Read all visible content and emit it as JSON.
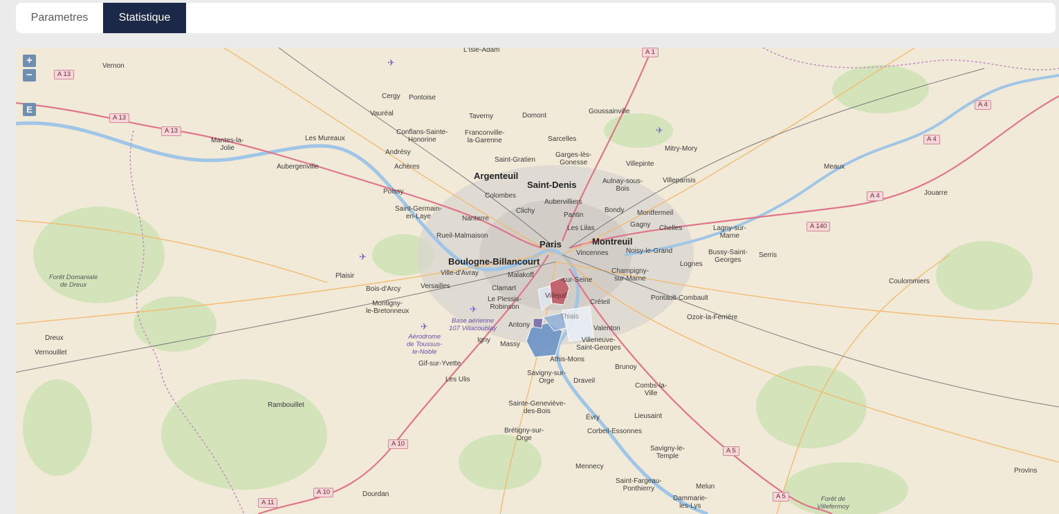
{
  "tabs": [
    {
      "label": "Parametres",
      "active": false
    },
    {
      "label": "Statistique",
      "active": true
    }
  ],
  "map_controls": {
    "zoom_in": "+",
    "zoom_out": "−",
    "export": "E"
  },
  "colors": {
    "tab_active": "#1b2847",
    "region_red": "#c15a66",
    "region_blue": "#6b93c8",
    "region_purple": "#7a6aa8"
  },
  "places": {
    "paris": "Paris",
    "montreuil": "Montreuil",
    "saint_denis": "Saint-Denis",
    "argenteuil": "Argenteuil",
    "boulogne": "Boulogne-Billancourt",
    "vernon": "Vernon",
    "isle_adam": "L'Isle-Adam",
    "cergy": "Cergy",
    "pontoise": "Pontoise",
    "vaureal": "Vauréal",
    "taverny": "Taverny",
    "domont": "Domont",
    "goussainville": "Goussainville",
    "conflans": "Conflans-Sainte-\nHonorine",
    "franconville": "Franconville-\nla-Garenne",
    "sarcelles": "Sarcelles",
    "garges": "Garges-lès-\nGonesse",
    "mitry": "Mitry-Mory",
    "les_mureaux": "Les Mureaux",
    "mantes": "Mantes-la-\nJolie",
    "andresy": "Andrésy",
    "saint_gratien": "Saint-Gratien",
    "villepinte": "Villepinte",
    "meaux": "Meaux",
    "aubergenville": "Aubergenville",
    "acheres": "Achères",
    "aulnay": "Aulnay-sous-\nBois",
    "villeparisis": "Villeparisis",
    "poissy": "Poissy",
    "colombes": "Colombes",
    "aubervilliers": "Aubervilliers",
    "jouarre": "Jouarre",
    "saint_germain": "Saint-Germain-\nen-Laye",
    "clichy": "Clichy",
    "pantin": "Pantin",
    "bondy": "Bondy",
    "montfermeil": "Montfermeil",
    "nanterre": "Nanterre",
    "les_lilas": "Les Lilas",
    "gagny": "Gagny",
    "chelles": "Chelles",
    "lagny": "Lagny-sur-\nMarne",
    "rueil": "Rueil-Malmaison",
    "vincennes": "Vincennes",
    "noisy": "Noisy-le-Grand",
    "bussy": "Bussy-Saint-\nGeorges",
    "serris": "Serris",
    "lognes": "Lognes",
    "plaisir": "Plaisir",
    "ville_davray": "Ville-d'Avray",
    "malakoff": "Malakoff",
    "champigny": "Champigny-\nsur-Marne",
    "coulommiers": "Coulommiers",
    "bois_arcy": "Bois-d'Arcy",
    "versailles": "Versailles",
    "clamart": "Clamart",
    "sur_seine": "-sur-Seine",
    "villejuif": "Villejuif",
    "montigny": "Montigny-\nle-Bretonneux",
    "le_plessis": "Le Plessis-\nRobinson",
    "creteil": "Créteil",
    "pontault": "Pontault-Combault",
    "ozoir": "Ozoir-la-Ferrière",
    "thiais": "Thiais",
    "antony": "Antony",
    "valenton": "Valenton",
    "igny": "Igny",
    "massy": "Massy",
    "villeneuve": "Villeneuve-\nSaint-Georges",
    "dreux": "Dreux",
    "vernouillet": "Vernouillet",
    "athis": "Athis-Mons",
    "gif": "Gif-sur-Yvette",
    "brunoy": "Brunoy",
    "les_ulis": "Les Ulis",
    "savigny_orge": "Savigny-sur-\nOrge",
    "draveil": "Draveil",
    "combs": "Combs-la-\nVille",
    "rambouillet": "Rambouillet",
    "sainte_genevieve": "Sainte-Geneviève-\ndes-Bois",
    "evry": "Évry",
    "lieusaint": "Lieusaint",
    "corbeil": "Corbeil-Essonnes",
    "bretigny": "Brétigny-sur-\nOrge",
    "savigny_temple": "Savigny-le-\nTemple",
    "mennecy": "Mennecy",
    "provins": "Provins",
    "saint_fargeau": "Saint-Fargeau-\nPonthierry",
    "melun": "Melun",
    "dourdan": "Dourdan",
    "dammarie": "Dammarie-\nles-Lys",
    "foret_dreux": "Forêt Domaniale\nde Dreux",
    "foret_villefermoy": "Forêt de\nVillefermoy",
    "base_aerienne": "Base aérienne\n107 Villacoublay",
    "aerodrome": "Aérodrome\nde Toussus-\nle-Noble"
  },
  "roads": {
    "a13": "A 13",
    "a1": "A 1",
    "a4": "A 4",
    "a140": "A 140",
    "a10": "A 10",
    "a5": "A 5",
    "a11": "A 11"
  }
}
